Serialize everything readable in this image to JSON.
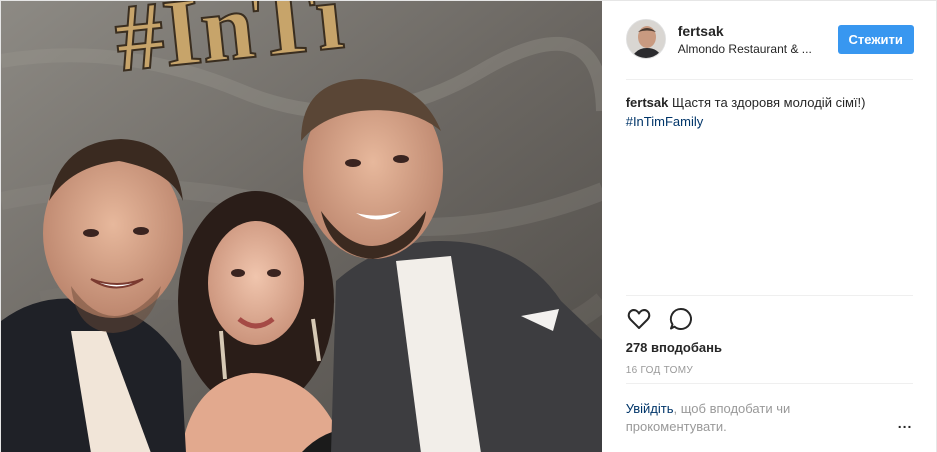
{
  "post": {
    "username": "fertsak",
    "location": "Almondo Restaurant & ...",
    "follow_label": "Стежити",
    "caption": {
      "username": "fertsak",
      "text": "Щастя та здоровя молодій сімї!)",
      "hashtag": "#InTimFamily"
    },
    "likes": "278 вподобань",
    "time": "16 ГОД ТОМУ",
    "login": {
      "link": "Увійдіть",
      "text": ", щоб вподобати чи прокоментувати."
    },
    "more_label": "..."
  },
  "photo": {
    "sign_text": "#InTi"
  },
  "icons": {
    "like": "heart-icon",
    "comment": "comment-icon"
  },
  "colors": {
    "follow_button": "#3897f0",
    "link": "#003569",
    "text": "#262626",
    "muted": "#999999"
  }
}
